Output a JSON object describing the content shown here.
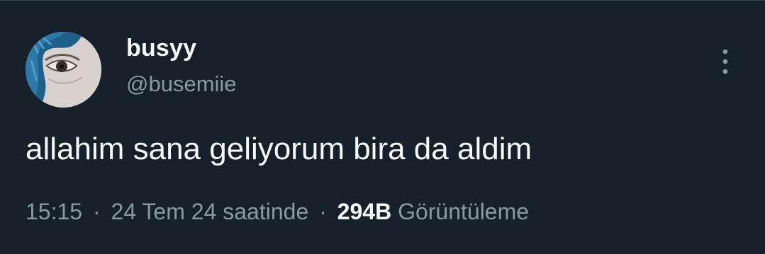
{
  "tweet": {
    "display_name": "busyy",
    "handle": "@busemiie",
    "text": "allahim sana geliyorum bira da aldim",
    "time": "15:15",
    "separator": "·",
    "date": "24 Tem 24 saatinde",
    "views_count": "294B",
    "views_label": "Görüntüleme"
  },
  "icons": {
    "more": "more-vertical-icon",
    "avatar": "avatar"
  },
  "colors": {
    "background": "#15202b",
    "text_primary": "#f7f9f9",
    "text_secondary": "#8b98a5",
    "border": "#38444d"
  }
}
